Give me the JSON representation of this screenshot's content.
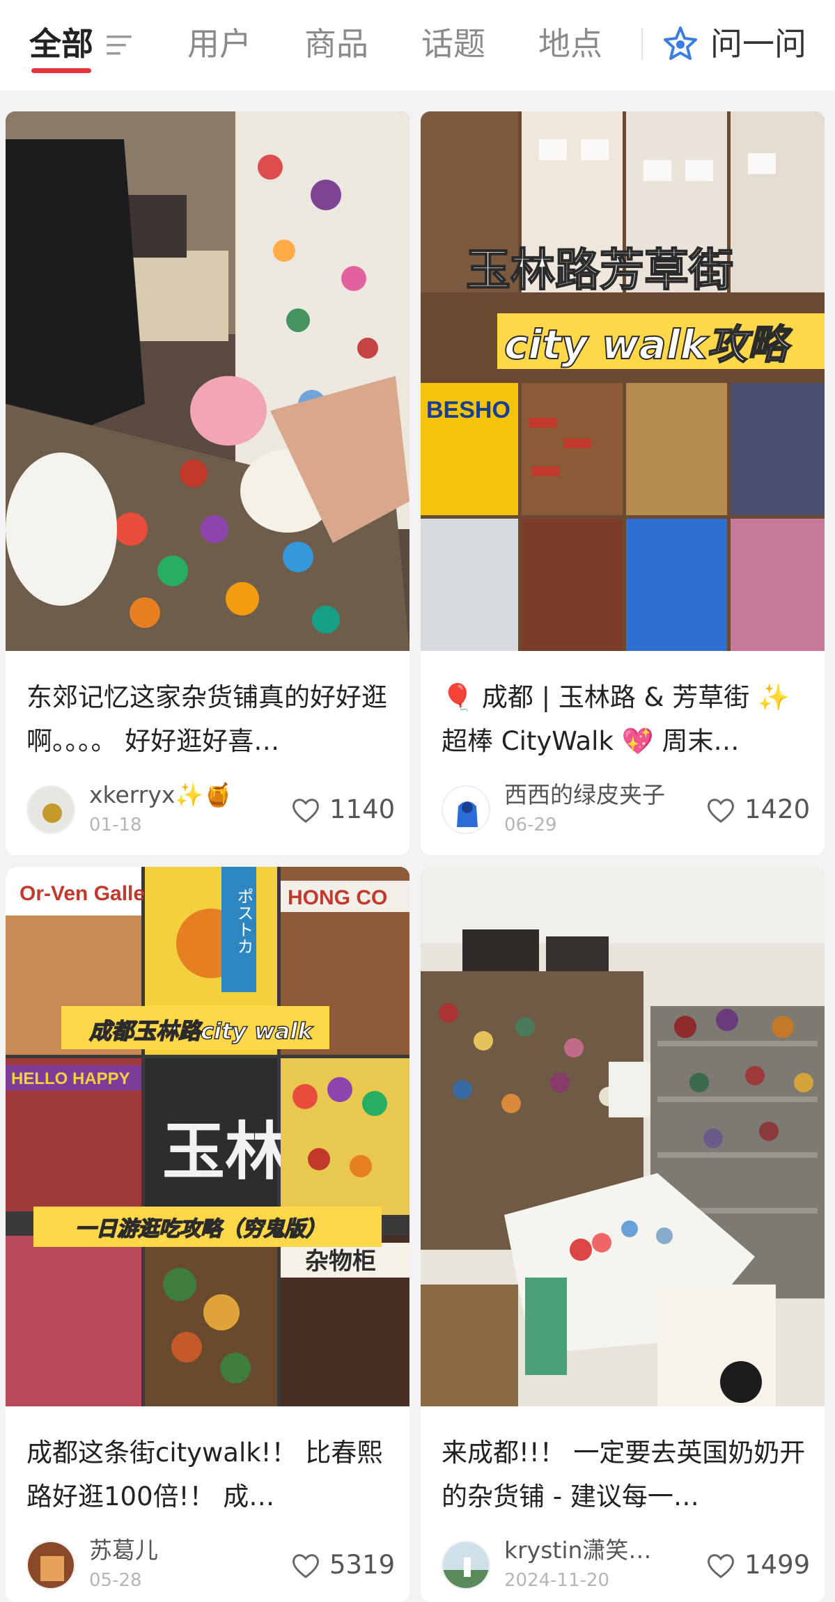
{
  "tabs": {
    "all": "全部",
    "users": "用户",
    "products": "商品",
    "topics": "话题",
    "places": "地点",
    "ask": "问一问"
  },
  "cards": [
    {
      "title": "东郊记忆这家杂货铺真的好好逛啊。。。。 好好逛好喜…",
      "author": "xkerryx✨🍯",
      "date": "01-18",
      "likes": "1140"
    },
    {
      "title": "🎈 成都 | 玉林路 & 芳草街 ✨ 超棒 CityWalk 💖 周末…",
      "author": "西西的绿皮夹子",
      "date": "06-29",
      "likes": "1420",
      "overlay_line1": "玉林路芳草街",
      "overlay_line2": "city walk攻略",
      "sign_text": "BESHO"
    },
    {
      "title": "成都这条街citywalk!！ 比春熙路好逛100倍!！ 成…",
      "author": "苏葛儿",
      "date": "05-28",
      "likes": "5319",
      "overlay_top": "成都玉林路city walk",
      "overlay_bottom": "一日游逛吃攻略（穷鬼版）",
      "sign_gallery": "Or-Ven Gallery",
      "sign_hongkong": "HONG CO",
      "sign_hello": "HELLO HAPPY",
      "sign_yulin": "玉林",
      "sign_poster": "ポストカ",
      "sign_shop": "杂物柜"
    },
    {
      "title": "来成都!!！ 一定要去英国奶奶开的杂货铺 - 建议每一…",
      "author": "krystin潇笑…",
      "date": "2024-11-20",
      "likes": "1499"
    }
  ],
  "colors": {
    "accent": "#e8323c",
    "overlay_yellow": "#ffd84a"
  }
}
